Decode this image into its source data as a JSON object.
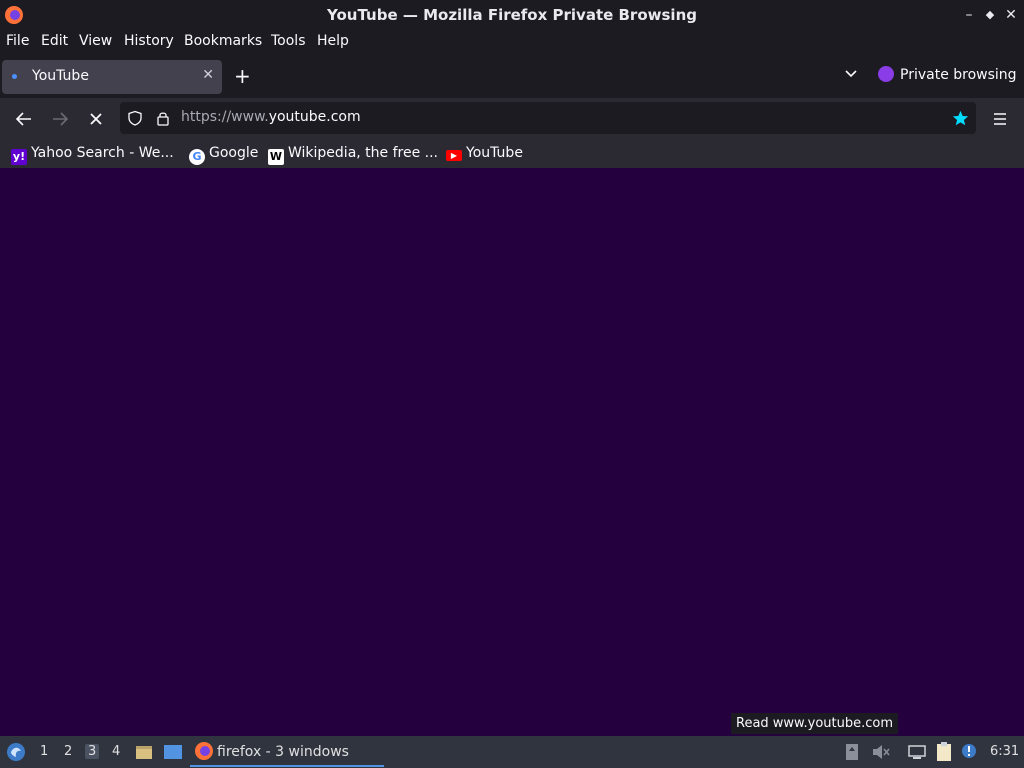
{
  "window": {
    "title": "YouTube — Mozilla Firefox Private Browsing"
  },
  "menubar": [
    "File",
    "Edit",
    "View",
    "History",
    "Bookmarks",
    "Tools",
    "Help"
  ],
  "tab": {
    "title": "YouTube",
    "private_label": "Private browsing"
  },
  "navbar": {
    "url_protocol": "https://www.",
    "url_host": "youtube.com"
  },
  "bookmarks": [
    {
      "label": "Yahoo Search - We...",
      "icon": "yahoo-icon"
    },
    {
      "label": "Google",
      "icon": "google-icon"
    },
    {
      "label": "Wikipedia, the free ...",
      "icon": "wikipedia-icon"
    },
    {
      "label": "YouTube",
      "icon": "youtube-icon"
    }
  ],
  "status_text": "Read www.youtube.com",
  "taskbar": {
    "workspaces": [
      "1",
      "2",
      "3",
      "4"
    ],
    "active_workspace": "3",
    "task_label": "firefox - 3 windows",
    "clock": "6:31"
  },
  "colors": {
    "content_bg": "#25003e",
    "accent": "#5294e2",
    "bookmark_star": "#00ddff"
  }
}
